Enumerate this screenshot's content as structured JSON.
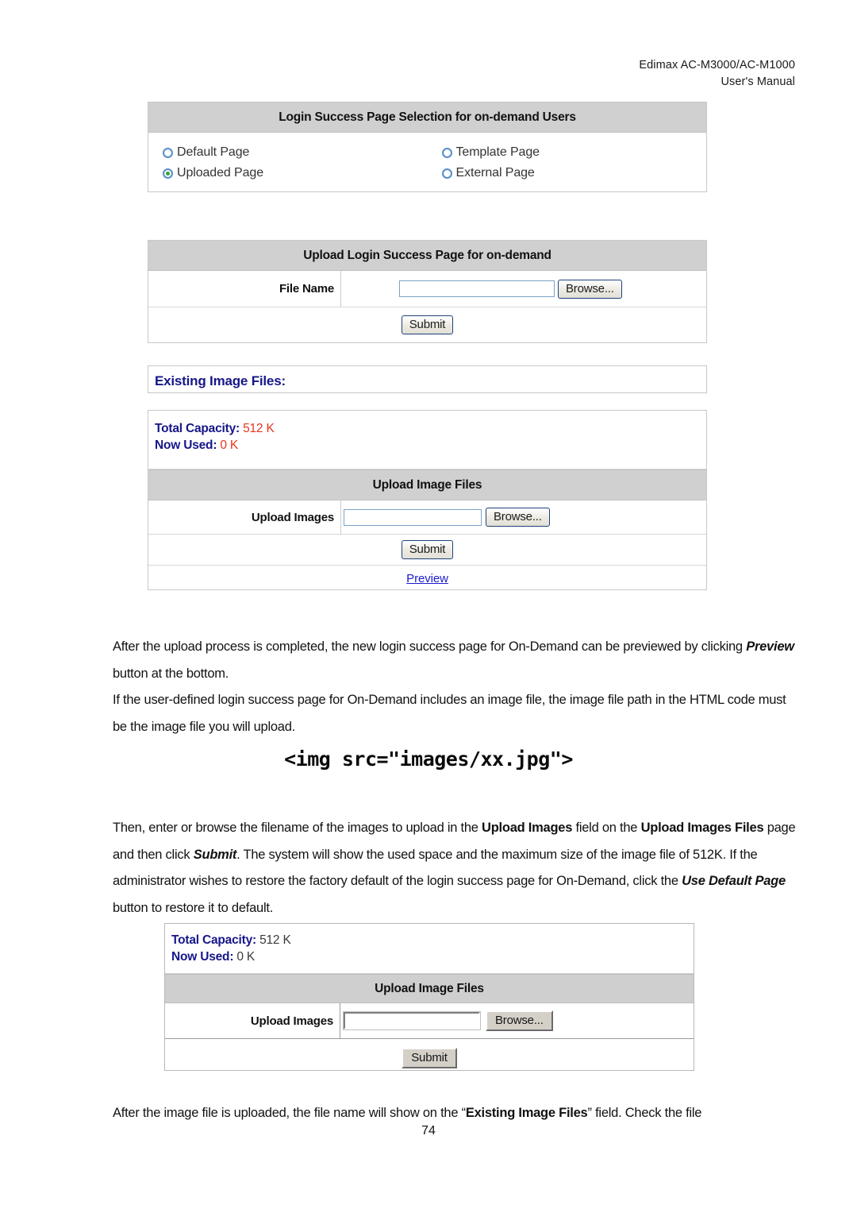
{
  "header": {
    "line1": "Edimax  AC-M3000/AC-M1000",
    "line2": "User's  Manual"
  },
  "panel_selection": {
    "title": "Login Success Page Selection for on-demand Users",
    "options": [
      {
        "label": "Default Page",
        "selected": false
      },
      {
        "label": "Template Page",
        "selected": false
      },
      {
        "label": "Uploaded Page",
        "selected": true
      },
      {
        "label": "External Page",
        "selected": false
      }
    ]
  },
  "panel_upload_page": {
    "title": "Upload Login Success Page for on-demand",
    "file_name_label": "File Name",
    "file_name_value": "",
    "file_name_placeholder": "",
    "browse_label": "Browse...",
    "submit_label": "Submit"
  },
  "panel_existing": {
    "heading": "Existing Image Files:"
  },
  "panel_capacity_top": {
    "total_capacity_label": "Total Capacity:",
    "total_capacity_value": "512 K",
    "now_used_label": "Now Used:",
    "now_used_value": "0 K",
    "upload_title": "Upload Image Files",
    "upload_images_label": "Upload Images",
    "upload_images_value": "",
    "browse_label": "Browse...",
    "submit_label": "Submit",
    "preview_label": "Preview"
  },
  "panel_capacity_bottom": {
    "total_capacity_label": "Total Capacity:",
    "total_capacity_value": "512 K",
    "now_used_label": "Now Used:",
    "now_used_value": "0 K",
    "upload_title": "Upload Image Files",
    "upload_images_label": "Upload Images",
    "upload_images_value": "",
    "browse_label": "Browse...",
    "submit_label": "Submit"
  },
  "body": {
    "para1_a": "After the upload process is completed, the new login success page for On-Demand can be previewed by clicking ",
    "para1_em": "Preview",
    "para1_b": " button at the bottom.",
    "para2": "If the user-defined login success page for On-Demand includes an image file, the image file path in the HTML code must be the image file you will upload.",
    "code": "<img src=\"images/xx.jpg\">",
    "para3_a": "Then, enter or browse the filename of the images to upload in the ",
    "para3_b1": "Upload Images",
    "para3_b": " field on the ",
    "para3_b2": "Upload Images Files",
    "para3_c": " page and then click ",
    "para3_em1": "Submit",
    "para3_d": ". The system will show the used space and the maximum size of the image file of 512K. If the administrator wishes to restore the factory default of the login success page for On-Demand, click the ",
    "para3_em2": "Use Default Page",
    "para3_e": " button to restore it to default.",
    "para4_a": "After the image file is uploaded, the file name will show on the “",
    "para4_b": "Existing Image Files",
    "para4_c": "” field. Check the file",
    "page_number": "74"
  },
  "colors": {
    "panel_title_bg": "#d0d0d0",
    "navy": "#161689",
    "red_value": "#e8341c",
    "link_blue": "#1a1ad0",
    "radio_selected_dot": "#2fa82f"
  }
}
